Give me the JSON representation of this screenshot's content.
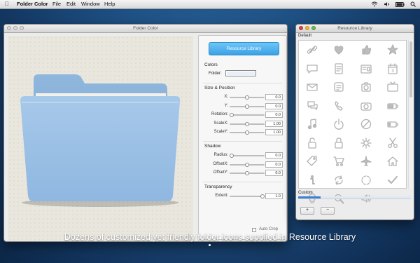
{
  "menubar": {
    "app": "Folder Color",
    "items": [
      "File",
      "Edit",
      "Window",
      "Help"
    ]
  },
  "main_window": {
    "title": "Folder Color",
    "resource_library_button": "Resource Library",
    "colors": {
      "section": "Colors",
      "folder_label": "Folder:",
      "folder_color": "#e7f0f8"
    },
    "size_position": {
      "section": "Size & Position",
      "rows": [
        {
          "label": "X:",
          "value": "0.0",
          "slider": 0.5
        },
        {
          "label": "Y:",
          "value": "0.0",
          "slider": 0.5
        },
        {
          "label": "Rotation:",
          "value": "0.0",
          "slider": 0.0
        },
        {
          "label": "ScaleX:",
          "value": "1.00",
          "slider": 0.5
        },
        {
          "label": "ScaleY:",
          "value": "1.00",
          "slider": 0.5
        }
      ]
    },
    "shadow": {
      "section": "Shadow",
      "rows": [
        {
          "label": "Radius:",
          "value": "0.0",
          "slider": 0.0
        },
        {
          "label": "OffsetX:",
          "value": "0.0",
          "slider": 0.5
        },
        {
          "label": "OffsetY:",
          "value": "0.0",
          "slider": 0.5
        }
      ]
    },
    "transparency": {
      "section": "Transparency",
      "rows": [
        {
          "label": "Extent:",
          "value": "1.0",
          "slider": 1.0
        }
      ]
    },
    "auto_crop": {
      "label": "Auto Crop",
      "checked": false
    }
  },
  "resource_window": {
    "title": "Resource Library",
    "default_label": "Default",
    "custom_label": "Custom",
    "icons": [
      "link-icon",
      "heart-icon",
      "thumbs-up-icon",
      "star-icon",
      "chat-bubble-icon",
      "notebook-icon",
      "news-icon",
      "calendar-icon",
      "mail-icon",
      "game-icon",
      "camera-icon",
      "tv-icon",
      "chat-icon",
      "phone-icon",
      "photo-camera-icon",
      "battery-icon",
      "music-note-icon",
      "power-icon",
      "no-entry-icon",
      "battery-low-icon",
      "lock-icon",
      "lock-closed-icon",
      "gear-icon",
      "scissors-icon",
      "tag-icon",
      "cart-icon",
      "airplane-icon",
      "home-icon",
      "info-icon",
      "refresh-icon",
      "loading-icon",
      "checkmark-icon",
      "lightbulb-icon",
      "magnifier-icon",
      "speaker-icon"
    ],
    "add_button": "+",
    "remove_button": "−"
  },
  "caption": "Dozens of customized yet friendly folder icons supplied in Resource Library"
}
